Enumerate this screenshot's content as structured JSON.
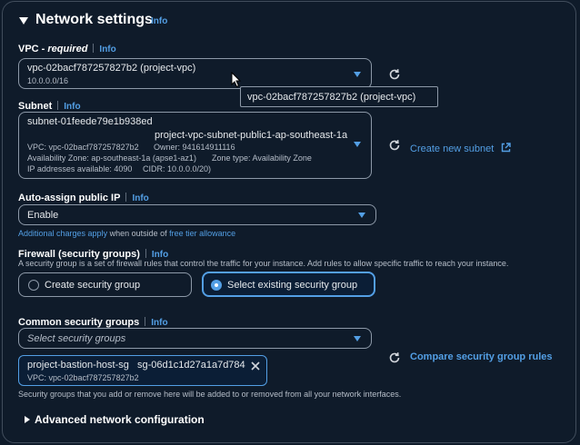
{
  "section": {
    "title": "Network settings",
    "info": "Info"
  },
  "vpc": {
    "label": "VPC - ",
    "required": "required",
    "info": "Info",
    "value": "vpc-02bacf787257827b2 (project-vpc)",
    "cidr": "10.0.0.0/16",
    "tooltip": "vpc-02bacf787257827b2 (project-vpc)"
  },
  "subnet": {
    "label": "Subnet",
    "info": "Info",
    "id": "subnet-01feede79e1b938ed",
    "name": "project-vpc-subnet-public1-ap-southeast-1a",
    "vpc_line": "VPC: vpc-02bacf787257827b2",
    "owner_line": "Owner: 941614911116",
    "az_line": "Availability Zone: ap-southeast-1a (apse1-az1)",
    "zone_type_line": "Zone type: Availability Zone",
    "ips_line": "IP addresses available: 4090",
    "cidr_line": "CIDR: 10.0.0.0/20)",
    "create_link": "Create new subnet"
  },
  "public_ip": {
    "label": "Auto-assign public IP",
    "info": "Info",
    "value": "Enable",
    "note_link1": "Additional charges apply",
    "note_text": " when outside of ",
    "note_link2": "free tier allowance"
  },
  "firewall": {
    "label": "Firewall (security groups)",
    "info": "Info",
    "description": "A security group is a set of firewall rules that control the traffic for your instance. Add rules to allow specific traffic to reach your instance.",
    "option_create": "Create security group",
    "option_existing": "Select existing security group",
    "selected": "existing"
  },
  "common_sg": {
    "label": "Common security groups",
    "info": "Info",
    "placeholder": "Select security groups",
    "token_name": "project-bastion-host-sg",
    "token_id": "sg-06d1c1d27a1a7d784",
    "token_vpc": "VPC: vpc-02bacf787257827b2",
    "compare_link": "Compare security group rules",
    "note": "Security groups that you add or remove here will be added to or removed from all your network interfaces."
  },
  "advanced": {
    "label": "Advanced network configuration"
  },
  "colors": {
    "accent": "#539fe5",
    "background": "#0f1b2a",
    "border": "#8d99a8"
  }
}
